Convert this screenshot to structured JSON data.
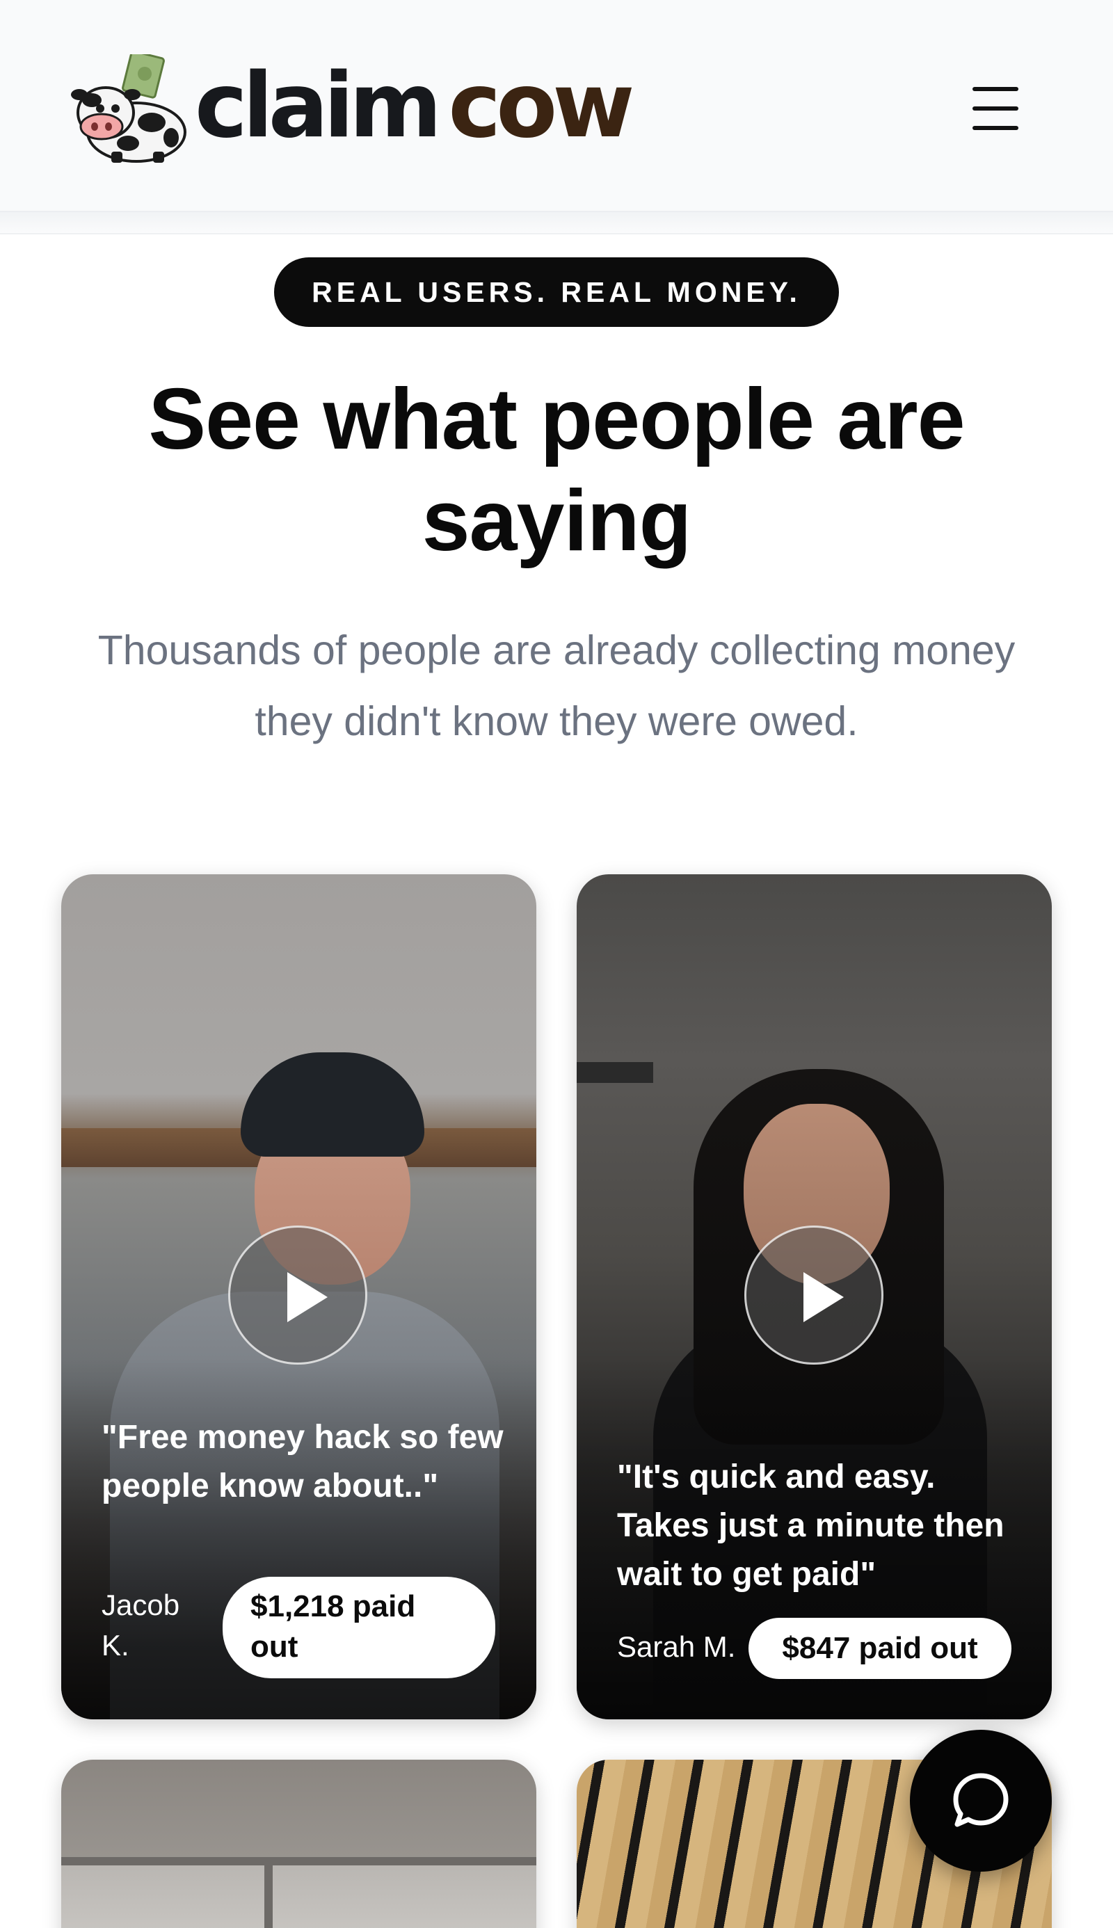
{
  "header": {
    "logo_word_1": "claim",
    "logo_word_2": "cow",
    "menu_icon": "hamburger-menu-icon"
  },
  "hero": {
    "badge": "REAL USERS. REAL MONEY.",
    "headline": "See what people are saying",
    "subhead": "Thousands of people are already collecting money they didn't know they were owed."
  },
  "testimonials": [
    {
      "quote": "\"Free money hack so few people know about..\"",
      "name": "Jacob K.",
      "payout": "$1,218 paid out"
    },
    {
      "quote": "\"It's quick and easy. Takes just a minute then wait to get paid\"",
      "name": "Sarah M.",
      "payout": "$847 paid out"
    }
  ],
  "chat": {
    "icon": "chat-bubble-icon"
  },
  "colors": {
    "brand_dark": "#17191d",
    "brand_brown": "#3b2412",
    "subhead_gray": "#6b7280",
    "badge_bg": "#0c0c0c"
  }
}
